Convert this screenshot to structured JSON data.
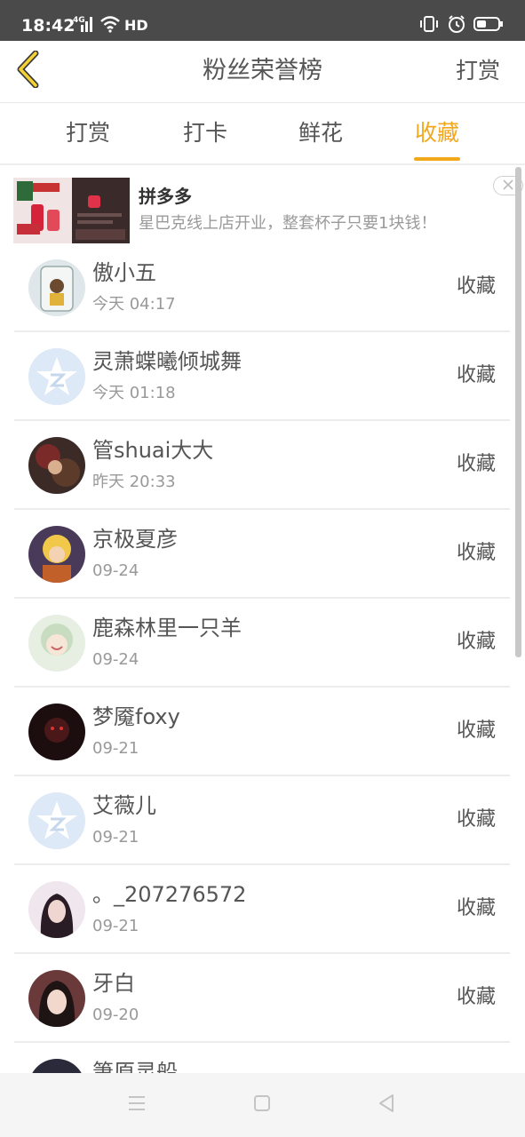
{
  "status_bar": {
    "time": "18:42",
    "network": "4G",
    "hd": "HD",
    "icons": [
      "signal-icon",
      "wifi-icon",
      "vibrate-icon",
      "alarm-icon",
      "battery-icon"
    ]
  },
  "header": {
    "title": "粉丝荣誉榜",
    "action": "打赏",
    "back_icon": "back-arrow-icon"
  },
  "tabs": [
    {
      "label": "打赏",
      "active": false
    },
    {
      "label": "打卡",
      "active": false
    },
    {
      "label": "鲜花",
      "active": false
    },
    {
      "label": "收藏",
      "active": true
    }
  ],
  "ad": {
    "title": "拼多多",
    "description": "星巴克线上店开业，整套杯子只要1块钱！"
  },
  "list": [
    {
      "name": "傲小五",
      "time": "今天 04:17",
      "action": "收藏"
    },
    {
      "name": "灵萧蝶曦倾城舞",
      "time": "今天 01:18",
      "action": "收藏"
    },
    {
      "name": "管shuai大大",
      "time": "昨天 20:33",
      "action": "收藏"
    },
    {
      "name": "京极夏彦",
      "time": "09-24",
      "action": "收藏"
    },
    {
      "name": "鹿森林里一只羊",
      "time": "09-24",
      "action": "收藏"
    },
    {
      "name": "梦魇foxy",
      "time": "09-21",
      "action": "收藏"
    },
    {
      "name": "艾薇儿",
      "time": "09-21",
      "action": "收藏"
    },
    {
      "name": "。_207276572",
      "time": "09-21",
      "action": "收藏"
    },
    {
      "name": "牙白",
      "time": "09-20",
      "action": "收藏"
    },
    {
      "name": "箫原灵船",
      "time": "",
      "action": ""
    }
  ],
  "colors": {
    "accent": "#f2a81d",
    "status_bar": "#4a4a4a",
    "text": "#555555",
    "muted": "#999999"
  }
}
